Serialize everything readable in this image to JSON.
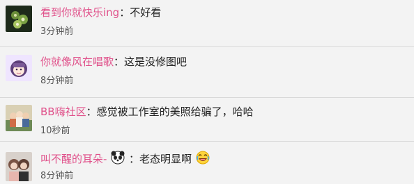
{
  "comments": [
    {
      "username": "看到你就快乐ing",
      "separator": "：",
      "text": "不好看",
      "time": "3分钟前",
      "avatar_icon": "kiwi-fruit-avatar-icon"
    },
    {
      "username": "你就像风在唱歌",
      "separator": "：",
      "text": "这是没修图吧",
      "time": "8分钟前",
      "avatar_icon": "anime-girl-avatar-icon"
    },
    {
      "username": "BB嗨社区",
      "separator": "：",
      "text": "感觉被工作室的美照给骗了，哈哈",
      "time": "10秒前",
      "avatar_icon": "group-photo-avatar-icon"
    },
    {
      "username": "叫不醒的耳朵-",
      "separator": "：",
      "text": "老态明显啊",
      "time": "8分钟前",
      "avatar_icon": "two-girls-avatar-icon",
      "name_emoji": "panda-emoji-icon",
      "text_emoji": "laughing-crying-emoji-icon"
    }
  ],
  "colors": {
    "username": "#e0508a",
    "background": "#f3f3f3",
    "divider": "#d8d8d8",
    "text": "#222222",
    "time": "#555555"
  }
}
